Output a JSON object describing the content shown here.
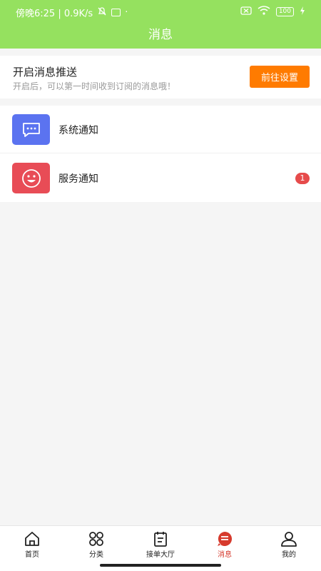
{
  "status": {
    "time_text": "傍晚6:25 | 0.9K/s",
    "battery": "100"
  },
  "header": {
    "title": "消息"
  },
  "notice": {
    "title": "开启消息推送",
    "subtitle": "开启后，可以第一时间收到订阅的消息哦！",
    "button_label": "前往设置"
  },
  "messages": [
    {
      "label": "系统通知",
      "icon": "chat-bubble-icon",
      "color": "#5b73f0"
    },
    {
      "label": "服务通知",
      "icon": "smile-icon",
      "color": "#e84c56",
      "badge": "1"
    }
  ],
  "tabs": [
    {
      "label": "首页",
      "icon": "home-icon"
    },
    {
      "label": "分类",
      "icon": "grid-icon"
    },
    {
      "label": "接单大厅",
      "icon": "clipboard-icon"
    },
    {
      "label": "消息",
      "icon": "message-icon",
      "active": true
    },
    {
      "label": "我的",
      "icon": "user-icon"
    }
  ],
  "colors": {
    "header": "#95e15f",
    "accent": "#ff7b00",
    "active_tab": "#d63a2d"
  }
}
